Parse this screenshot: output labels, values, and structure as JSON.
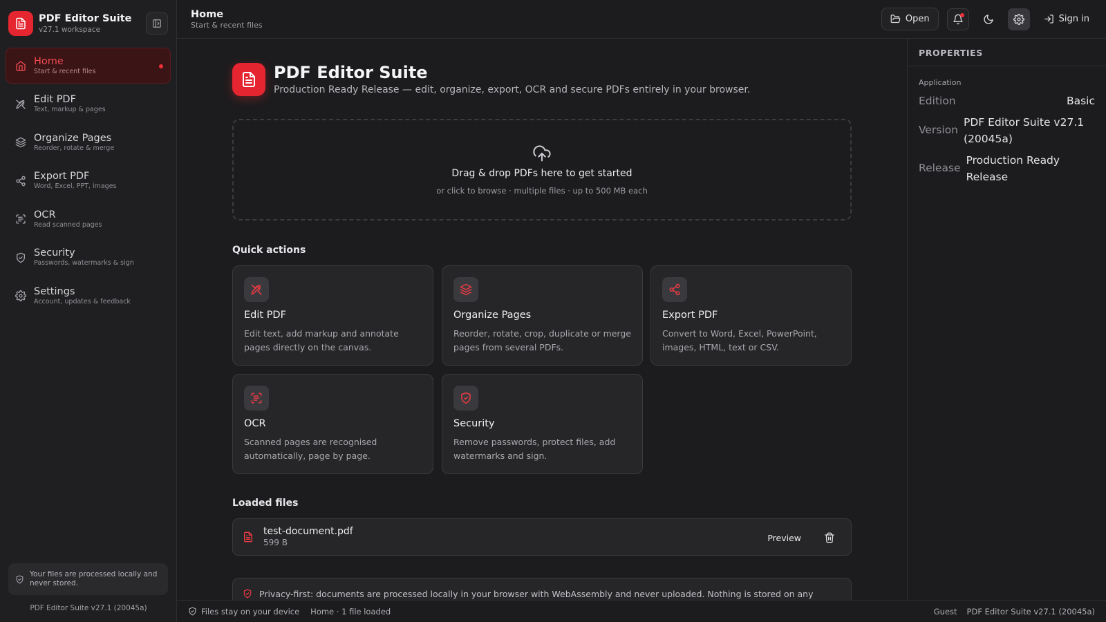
{
  "sidebar": {
    "brand_title": "PDF Editor Suite",
    "brand_sub": "v27.1 workspace",
    "items": [
      {
        "label": "Home",
        "sub": "Start & recent files"
      },
      {
        "label": "Edit PDF",
        "sub": "Text, markup & pages"
      },
      {
        "label": "Organize Pages",
        "sub": "Reorder, rotate & merge"
      },
      {
        "label": "Export PDF",
        "sub": "Word, Excel, PPT, images"
      },
      {
        "label": "OCR",
        "sub": "Read scanned pages"
      },
      {
        "label": "Security",
        "sub": "Passwords, watermarks & sign"
      },
      {
        "label": "Settings",
        "sub": "Account, updates & feedback"
      }
    ],
    "privacy_note": "Your files are processed locally and never stored.",
    "version": "PDF Editor Suite v27.1 (20045a)"
  },
  "header": {
    "title": "Home",
    "subtitle": "Start & recent files",
    "open_label": "Open",
    "signin_label": "Sign in"
  },
  "hero": {
    "title": "PDF Editor Suite",
    "subtitle": "Production Ready Release — edit, organize, export, OCR and secure PDFs entirely in your browser."
  },
  "dropzone": {
    "title": "Drag & drop PDFs here to get started",
    "subtitle": "or click to browse · multiple files · up to 500 MB each"
  },
  "quick_actions": {
    "heading": "Quick actions",
    "cards": [
      {
        "title": "Edit PDF",
        "desc": "Edit text, add markup and annotate pages directly on the canvas.",
        "icon": "pen-tool-icon"
      },
      {
        "title": "Organize Pages",
        "desc": "Reorder, rotate, crop, duplicate or merge pages from several PDFs.",
        "icon": "layers-icon"
      },
      {
        "title": "Export PDF",
        "desc": "Convert to Word, Excel, PowerPoint, images, HTML, text or CSV.",
        "icon": "share-icon"
      },
      {
        "title": "OCR",
        "desc": "Scanned pages are recognised automatically, page by page.",
        "icon": "scan-text-icon"
      },
      {
        "title": "Security",
        "desc": "Remove passwords, protect files, add watermarks and sign.",
        "icon": "shield-icon"
      }
    ]
  },
  "loaded_files": {
    "heading": "Loaded files",
    "files": [
      {
        "name": "test-document.pdf",
        "size": "599 B"
      }
    ],
    "preview_label": "Preview"
  },
  "banner": {
    "text": "Privacy-first: documents are processed locally in your browser with WebAssembly and never uploaded. Nothing is stored on any server."
  },
  "properties": {
    "heading": "PROPERTIES",
    "group": "Application",
    "rows": [
      {
        "key": "Edition",
        "value": "Basic"
      },
      {
        "key": "Version",
        "value": "PDF Editor Suite v27.1 (20045a)"
      },
      {
        "key": "Release",
        "value": "Production Ready Release"
      }
    ]
  },
  "statusbar": {
    "left": "Files stay on your device",
    "middle": "Home · 1 file loaded",
    "user": "Guest",
    "version": "PDF Editor Suite v27.1 (20045a)"
  },
  "colors": {
    "accent": "#e5252f",
    "background": "#1c1c1e",
    "card": "#262628"
  }
}
